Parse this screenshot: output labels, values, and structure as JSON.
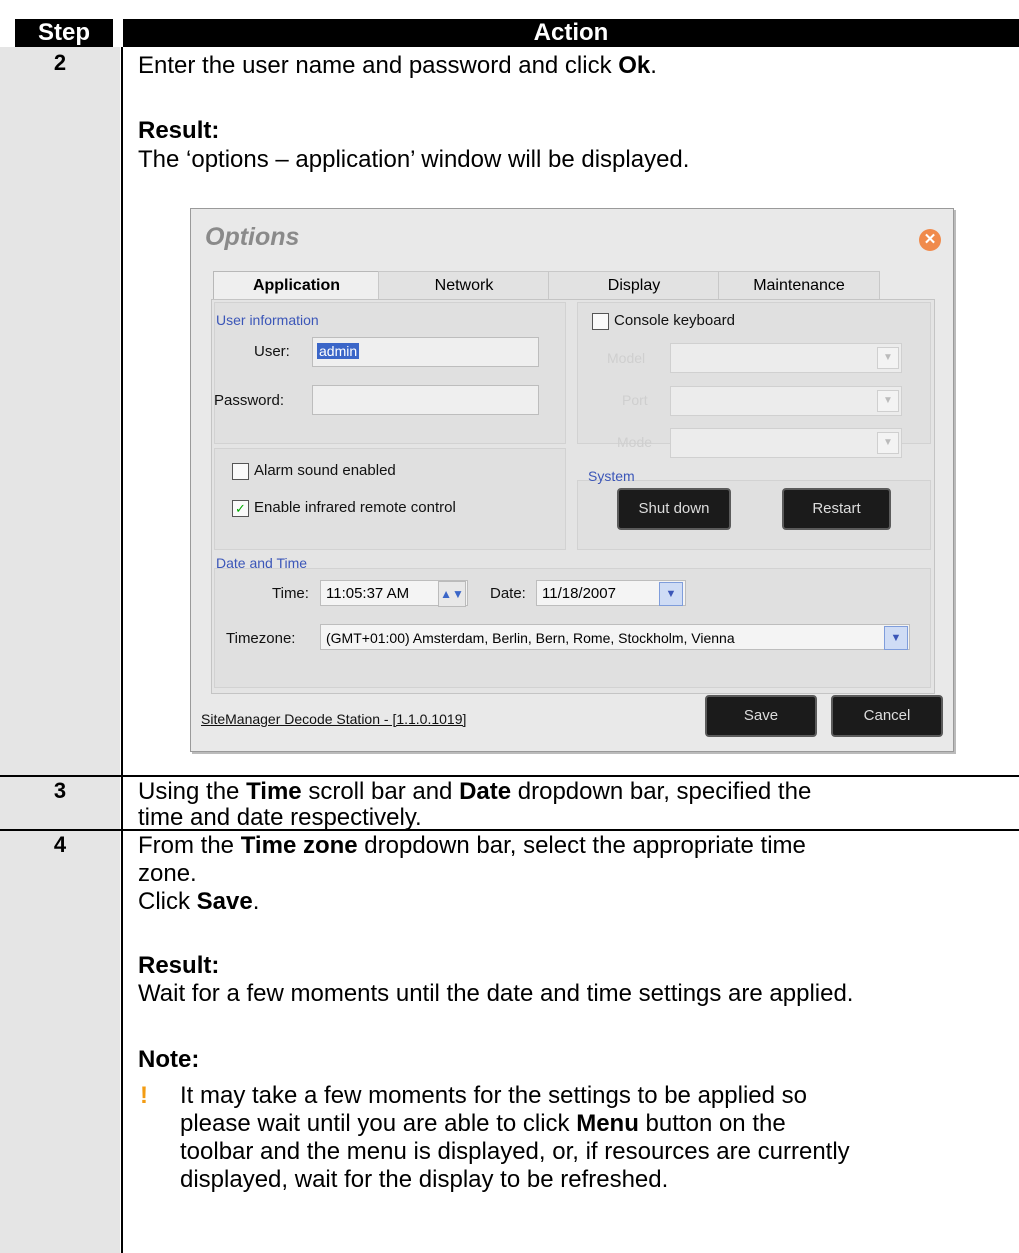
{
  "table": {
    "header_step": "Step",
    "header_action": "Action"
  },
  "rows": {
    "r2": {
      "step": "2",
      "line1_pre": "Enter the user name and password and click ",
      "line1_bold": "Ok",
      "line1_post": ".",
      "result_label": "Result:",
      "result_text": "The ‘options – application’ window will be displayed."
    },
    "r3": {
      "step": "3",
      "pre": "Using the ",
      "b1": "Time",
      "mid": " scroll bar and ",
      "b2": "Date",
      "post": " dropdown bar, specified the",
      "line2": "time and date respectively."
    },
    "r4": {
      "step": "4",
      "pre": "From the ",
      "b1": "Time zone",
      "post": " dropdown bar, select the appropriate time",
      "line2": "zone.",
      "click_pre": "Click ",
      "click_bold": "Save",
      "click_post": ".",
      "result_label": "Result:",
      "result_text": "Wait for a few moments until the date and time settings are applied.",
      "note_label": "Note:",
      "bullet": "!",
      "note_l1": "It may take a few moments for the settings to be applied so",
      "note_l2_pre": "please wait until you are able to click ",
      "note_l2_bold": "Menu",
      "note_l2_post": " button on the",
      "note_l3": "toolbar and the menu is displayed, or, if resources are currently",
      "note_l4": "displayed, wait for the display to be refreshed."
    }
  },
  "dialog": {
    "title": "Options",
    "close_icon": "✕",
    "tabs": [
      "Application",
      "Network",
      "Display",
      "Maintenance"
    ],
    "user_info_group": "User information",
    "user_label": "User:",
    "user_value": "admin",
    "password_label": "Password:",
    "console_keyboard": "Console keyboard",
    "kb_labels": [
      "Model",
      "Port",
      "Mode"
    ],
    "alarm_sound": "Alarm sound enabled",
    "enable_infrared": "Enable infrared remote control",
    "system_group": "System",
    "shut_down": "Shut down",
    "restart": "Restart",
    "datetime_group": "Date and Time",
    "time_label": "Time:",
    "time_value": "11:05:37 AM",
    "date_label": "Date:",
    "date_value": "11/18/2007",
    "timezone_label": "Timezone:",
    "timezone_value": "(GMT+01:00) Amsterdam, Berlin, Bern, Rome, Stockholm, Vienna",
    "footer": "SiteManager Decode Station - [1.1.0.1019]",
    "save": "Save",
    "cancel": "Cancel"
  }
}
